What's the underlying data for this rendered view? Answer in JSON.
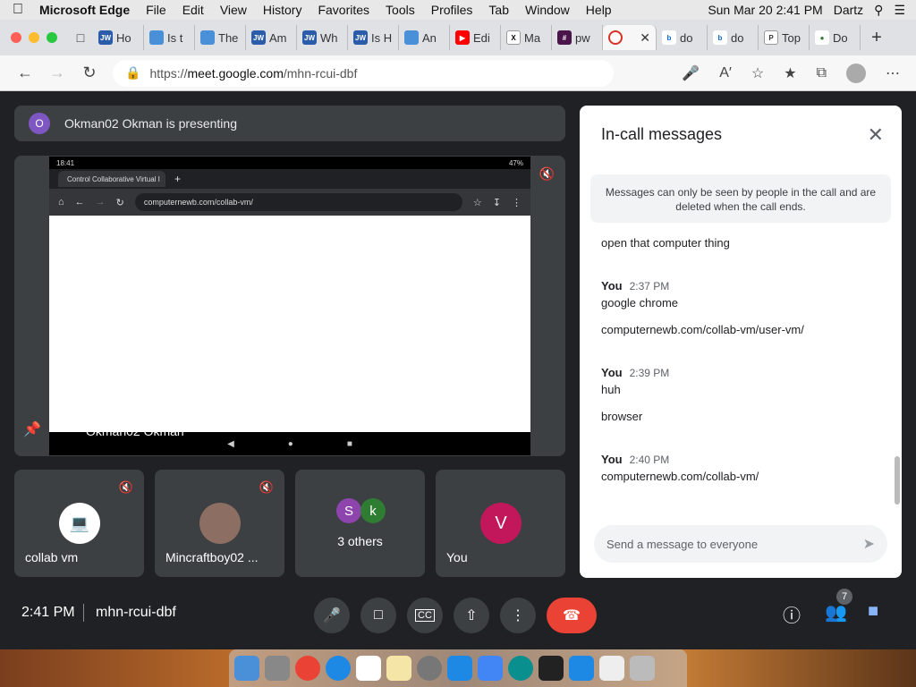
{
  "menubar": {
    "app_name": "Microsoft Edge",
    "items": [
      "File",
      "Edit",
      "View",
      "History",
      "Favorites",
      "Tools",
      "Profiles",
      "Tab",
      "Window",
      "Help"
    ],
    "clock": "Sun Mar 20  2:41 PM",
    "user": "Dartz"
  },
  "browser": {
    "tabs": [
      {
        "label": "Ho",
        "favicon": "JW"
      },
      {
        "label": "Is t",
        "favicon": "doc"
      },
      {
        "label": "The",
        "favicon": "doc"
      },
      {
        "label": "Am",
        "favicon": "JW"
      },
      {
        "label": "Wh",
        "favicon": "JW"
      },
      {
        "label": "Is H",
        "favicon": "JW"
      },
      {
        "label": "An",
        "favicon": "doc"
      },
      {
        "label": "Edi",
        "favicon": "youtube"
      },
      {
        "label": "Ma",
        "favicon": "X"
      },
      {
        "label": "pw",
        "favicon": "#"
      },
      {
        "label": "",
        "favicon": "record",
        "active": true
      },
      {
        "label": "do",
        "favicon": "bing"
      },
      {
        "label": "do",
        "favicon": "bing"
      },
      {
        "label": "Top",
        "favicon": "P"
      },
      {
        "label": "Do",
        "favicon": "dot"
      }
    ],
    "url_prefix": "https://",
    "url_domain": "meet.google.com",
    "url_path": "/mhn-rcui-dbf"
  },
  "meet": {
    "presenting_banner": "Okman02 Okman is presenting",
    "presenter_initial": "O",
    "presenter_name": "Okman02 Okman",
    "shared_screen": {
      "status_time": "18:41",
      "battery": "47%",
      "tab_title": "Control Collaborative Virtual I",
      "url": "computernewb.com/collab-vm/"
    },
    "participants": [
      {
        "name": "collab vm",
        "muted": true
      },
      {
        "name": "Mincraftboy02 ...",
        "muted": true
      },
      {
        "name": "3 others",
        "initials": [
          "S",
          "k"
        ]
      },
      {
        "name": "You",
        "initial": "V"
      }
    ],
    "meeting_time": "2:41 PM",
    "meeting_code": "mhn-rcui-dbf",
    "participant_count": "7"
  },
  "chat": {
    "title": "In-call messages",
    "notice": "Messages can only be seen by people in the call and are deleted when the call ends.",
    "messages": [
      {
        "text": "open that computer thing"
      },
      {
        "sender": "You",
        "time": "2:37 PM",
        "text": "google chrome"
      },
      {
        "text": "computernewb.com/collab-vm/user-vm/"
      },
      {
        "sender": "You",
        "time": "2:39 PM",
        "text": "huh"
      },
      {
        "text": "browser"
      },
      {
        "sender": "You",
        "time": "2:40 PM",
        "text": "computernewb.com/collab-vm/"
      }
    ],
    "input_placeholder": "Send a message to everyone"
  },
  "colors": {
    "leave_button": "#ea4335",
    "you_avatar": "#c2185b",
    "s_avatar": "#8e44ad",
    "k_avatar": "#2e7d32",
    "presenter_avatar": "#7e57c2"
  }
}
